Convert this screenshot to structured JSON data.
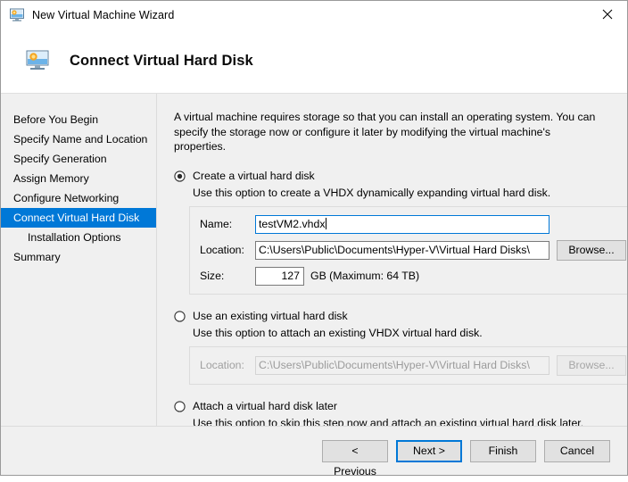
{
  "window": {
    "title": "New Virtual Machine Wizard",
    "title_icon": "virtual-machine-icon",
    "close_label": "✕"
  },
  "header": {
    "title": "Connect Virtual Hard Disk",
    "icon": "virtual-machine-icon"
  },
  "sidebar": {
    "items": [
      {
        "label": "Before You Begin",
        "selected": false,
        "indent": false
      },
      {
        "label": "Specify Name and Location",
        "selected": false,
        "indent": false
      },
      {
        "label": "Specify Generation",
        "selected": false,
        "indent": false
      },
      {
        "label": "Assign Memory",
        "selected": false,
        "indent": false
      },
      {
        "label": "Configure Networking",
        "selected": false,
        "indent": false
      },
      {
        "label": "Connect Virtual Hard Disk",
        "selected": true,
        "indent": false
      },
      {
        "label": "Installation Options",
        "selected": false,
        "indent": true
      },
      {
        "label": "Summary",
        "selected": false,
        "indent": false
      }
    ]
  },
  "main": {
    "intro": "A virtual machine requires storage so that you can install an operating system. You can specify the storage now or configure it later by modifying the virtual machine's properties.",
    "options": [
      {
        "label": "Create a virtual hard disk",
        "description": "Use this option to create a VHDX dynamically expanding virtual hard disk.",
        "selected": true
      },
      {
        "label": "Use an existing virtual hard disk",
        "description": "Use this option to attach an existing VHDX virtual hard disk.",
        "selected": false
      },
      {
        "label": "Attach a virtual hard disk later",
        "description": "Use this option to skip this step now and attach an existing virtual hard disk later.",
        "selected": false
      }
    ],
    "create_form": {
      "name_label": "Name:",
      "name_value": "testVM2.vhdx",
      "location_label": "Location:",
      "location_value": "C:\\Users\\Public\\Documents\\Hyper-V\\Virtual Hard Disks\\",
      "browse_label": "Browse...",
      "size_label": "Size:",
      "size_value": "127",
      "size_suffix": "GB (Maximum: 64 TB)"
    },
    "existing_form": {
      "location_label": "Location:",
      "location_value": "C:\\Users\\Public\\Documents\\Hyper-V\\Virtual Hard Disks\\",
      "browse_label": "Browse..."
    }
  },
  "footer": {
    "previous_label": "< Previous",
    "next_label": "Next >",
    "finish_label": "Finish",
    "cancel_label": "Cancel"
  },
  "colors": {
    "accent": "#0078d7",
    "window_bg": "#f0f0f0",
    "panel_bg": "#ffffff"
  }
}
